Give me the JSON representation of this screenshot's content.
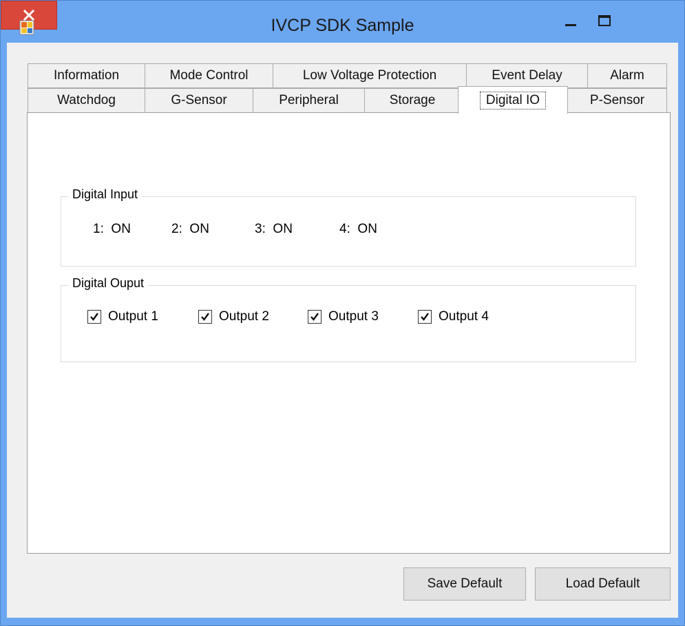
{
  "window": {
    "title": "IVCP SDK Sample"
  },
  "tabs_row1": [
    "Information",
    "Mode Control",
    "Low Voltage Protection",
    "Event Delay",
    "Alarm"
  ],
  "tabs_row2": [
    "Watchdog",
    "G-Sensor",
    "Peripheral",
    "Storage",
    "Digital IO",
    "P-Sensor"
  ],
  "active_tab": "Digital IO",
  "digital_input": {
    "legend": "Digital Input",
    "items": [
      {
        "label": "1:",
        "value": "ON"
      },
      {
        "label": "2:",
        "value": "ON"
      },
      {
        "label": "3:",
        "value": "ON"
      },
      {
        "label": "4:",
        "value": "ON"
      }
    ]
  },
  "digital_output": {
    "legend": "Digital Ouput",
    "items": [
      {
        "label": "Output 1",
        "checked": true
      },
      {
        "label": "Output 2",
        "checked": true
      },
      {
        "label": "Output 3",
        "checked": true
      },
      {
        "label": "Output 4",
        "checked": true
      }
    ]
  },
  "buttons": {
    "save": "Save Default",
    "load": "Load Default"
  },
  "colors": {
    "titlebar": "#6ba6f1",
    "close": "#d9473a",
    "panel": "#f0f0f0"
  }
}
